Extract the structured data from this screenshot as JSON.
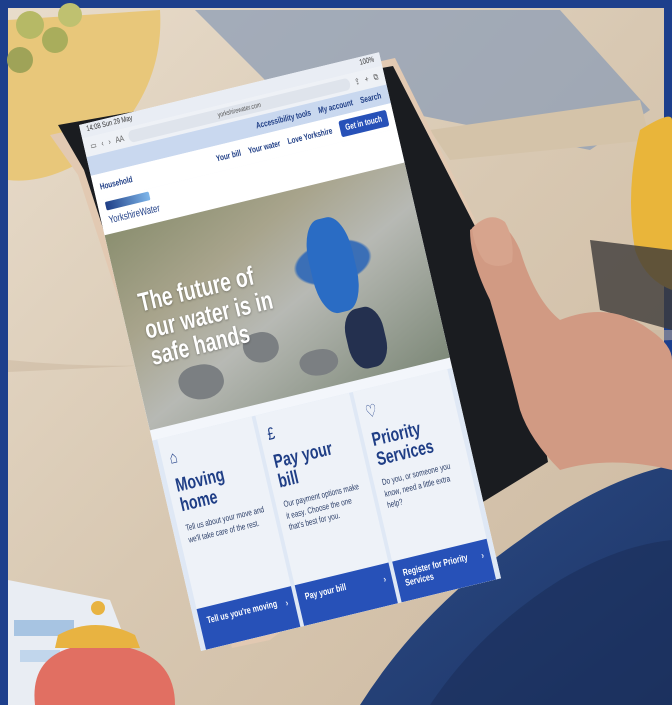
{
  "status": {
    "time": "14:08  Sun 29 May",
    "battery": "100%"
  },
  "browser": {
    "text_size": "AA",
    "url": "yorkshirewater.com"
  },
  "top_links": [
    "Accessibility tools",
    "My account",
    "Search"
  ],
  "nav": {
    "household": "Household",
    "items": [
      "Your bill",
      "Your water",
      "Love Yorkshire"
    ],
    "cta": "Get in touch"
  },
  "logo": {
    "name": "YorkshireWater"
  },
  "hero": {
    "headline": "The future of our water is in safe hands"
  },
  "cards": [
    {
      "icon": "house-icon",
      "title": "Moving home",
      "text": "Tell us about your move and we'll take care of the rest.",
      "cta": "Tell us you're moving"
    },
    {
      "icon": "pound-icon",
      "title": "Pay your bill",
      "text": "Our payment options make it easy. Choose the one that's best for you.",
      "cta": "Pay your bill"
    },
    {
      "icon": "heart-icon",
      "title": "Priority Services",
      "text": "Do you, or someone you know, need a little extra help?",
      "cta": "Register for Priority Services"
    }
  ],
  "colors": {
    "brand_blue": "#1f3e86",
    "button_blue": "#2751b8",
    "frame_blue": "#1d3f8c",
    "purse": "#e16f62"
  }
}
